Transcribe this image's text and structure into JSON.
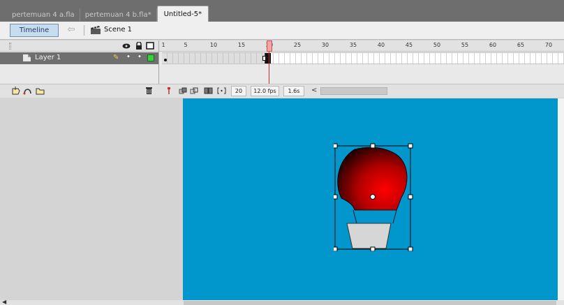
{
  "document_tabs": [
    {
      "label": "pertemuan 4 a.fla",
      "active": false
    },
    {
      "label": "pertemuan 4 b.fla*",
      "active": false
    },
    {
      "label": "Untitled-5*",
      "active": true
    }
  ],
  "edit_bar": {
    "timeline_button": "Timeline",
    "back_icon": "back-arrow-icon",
    "scene_icon": "clapperboard-icon",
    "scene_label": "Scene 1"
  },
  "timeline": {
    "header_icons": [
      "show-hide-eye-icon",
      "lock-icon",
      "outline-icon"
    ],
    "ruler_labels": [
      "1",
      "5",
      "10",
      "15",
      "20",
      "25",
      "30",
      "35",
      "40",
      "45",
      "50",
      "55",
      "60",
      "65",
      "70"
    ],
    "current_frame_marker": 20,
    "layer": {
      "name": "Layer 1",
      "outline_color": "#36d13b"
    },
    "footer": {
      "icons": [
        "new-layer-icon",
        "motion-guide-icon",
        "new-folder-icon",
        "trash-icon",
        "center-frame-icon",
        "onion-skin-icon",
        "onion-skin-outlines-icon",
        "edit-multiple-frames-icon",
        "modify-markers-icon"
      ],
      "current_frame": "20",
      "frame_rate": "12.0 fps",
      "elapsed_time": "1.6s",
      "scroll_arrow": "<"
    }
  },
  "stage": {
    "background": "#0197cc",
    "object": "hot-air-balloon",
    "balloon_gradient": [
      "#ff0000",
      "#000000"
    ],
    "basket_color": "#d6d6d6",
    "selected": true
  },
  "colors": {
    "tab_strip": "#6e6e6e",
    "layer_row": "#6f6f6f",
    "playhead": "#d22a2a"
  }
}
